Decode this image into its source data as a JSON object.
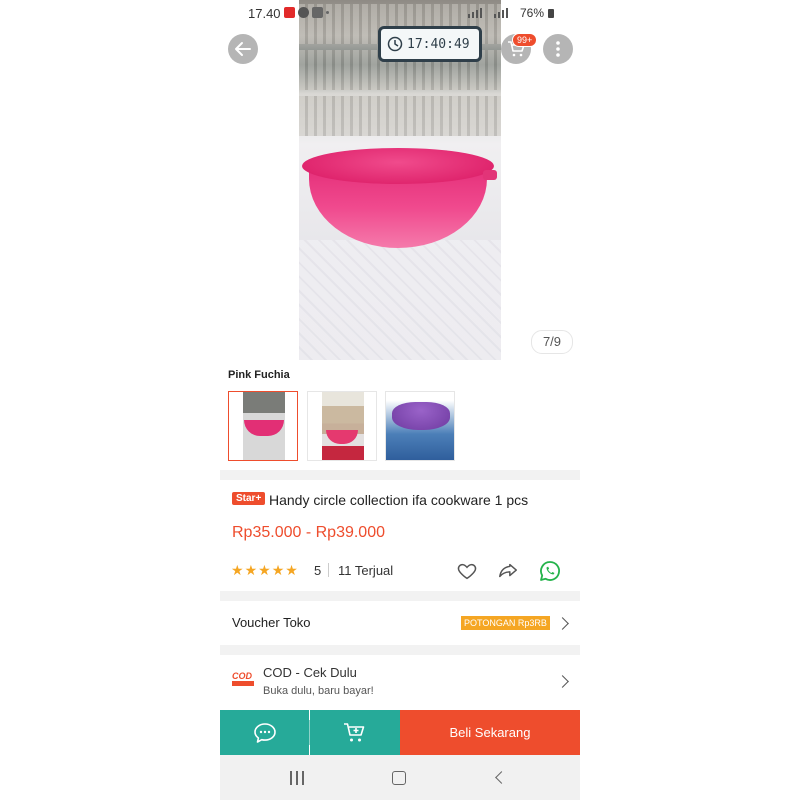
{
  "status_bar": {
    "time": "17.40",
    "battery": "76%"
  },
  "header": {
    "timer": "17:40:49",
    "cart_badge": "99+"
  },
  "gallery": {
    "counter": "7/9"
  },
  "variation": {
    "label": "Pink Fuchia"
  },
  "product": {
    "badge": "Star+",
    "title": "Handy circle collection ifa cookware 1 pcs",
    "price": "Rp35.000 - Rp39.000",
    "rating": "5",
    "sold": "11 Terjual"
  },
  "voucher": {
    "label": "Voucher Toko",
    "badge": "POTONGAN Rp3RB"
  },
  "cod": {
    "title": "COD - Cek Dulu",
    "subtitle": "Buka dulu, baru bayar!",
    "logo_text": "COD"
  },
  "actions": {
    "buy_now": "Beli Sekarang"
  },
  "colors": {
    "accent": "#ee4d2d",
    "teal": "#26aa99",
    "star": "#f5a623"
  }
}
